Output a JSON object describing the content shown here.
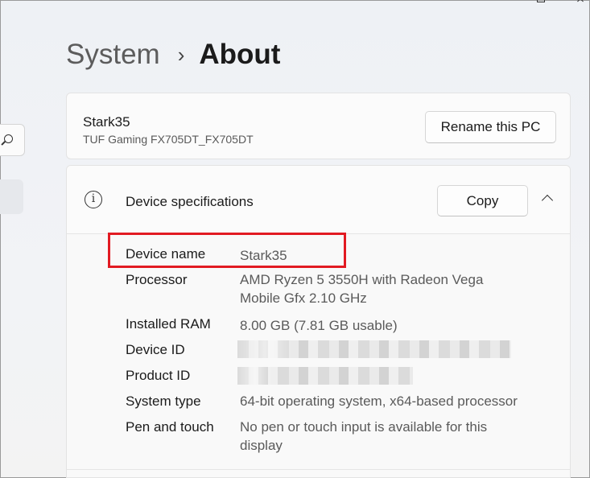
{
  "breadcrumb": {
    "parent": "System",
    "separator": "›",
    "current": "About"
  },
  "pc": {
    "name": "Stark35",
    "model": "TUF Gaming FX705DT_FX705DT",
    "rename_label": "Rename this PC"
  },
  "specs": {
    "title": "Device specifications",
    "copy_label": "Copy",
    "info_glyph": "i",
    "rows": [
      {
        "label": "Device name",
        "value": "Stark35"
      },
      {
        "label": "Processor",
        "value": "AMD Ryzen 5 3550H with Radeon Vega Mobile Gfx     2.10 GHz"
      },
      {
        "label": "Installed RAM",
        "value": "8.00 GB (7.81 GB usable)"
      },
      {
        "label": "Device ID",
        "value": ""
      },
      {
        "label": "Product ID",
        "value": ""
      },
      {
        "label": "System type",
        "value": "64-bit operating system, x64-based processor"
      },
      {
        "label": "Pen and touch",
        "value": "No pen or touch input is available for this display"
      }
    ]
  },
  "colors": {
    "highlight": "#e21a22",
    "accent_text": "#1b1b1b",
    "secondary_text": "#5a5a5a"
  }
}
